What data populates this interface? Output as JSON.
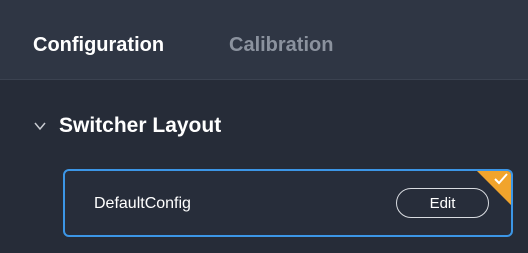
{
  "tabs": {
    "configuration": "Configuration",
    "calibration": "Calibration"
  },
  "section": {
    "title": "Switcher Layout",
    "expanded": true
  },
  "config_item": {
    "name": "DefaultConfig",
    "edit_label": "Edit",
    "selected": true
  },
  "colors": {
    "background": "#262c38",
    "header_background": "#2f3644",
    "accent_border": "#3c96e6",
    "selected_corner": "#f1a42c",
    "inactive_tab": "#8b929e"
  },
  "icons": {
    "section_toggle": "chevron-down-icon",
    "selected_marker": "check-icon"
  }
}
